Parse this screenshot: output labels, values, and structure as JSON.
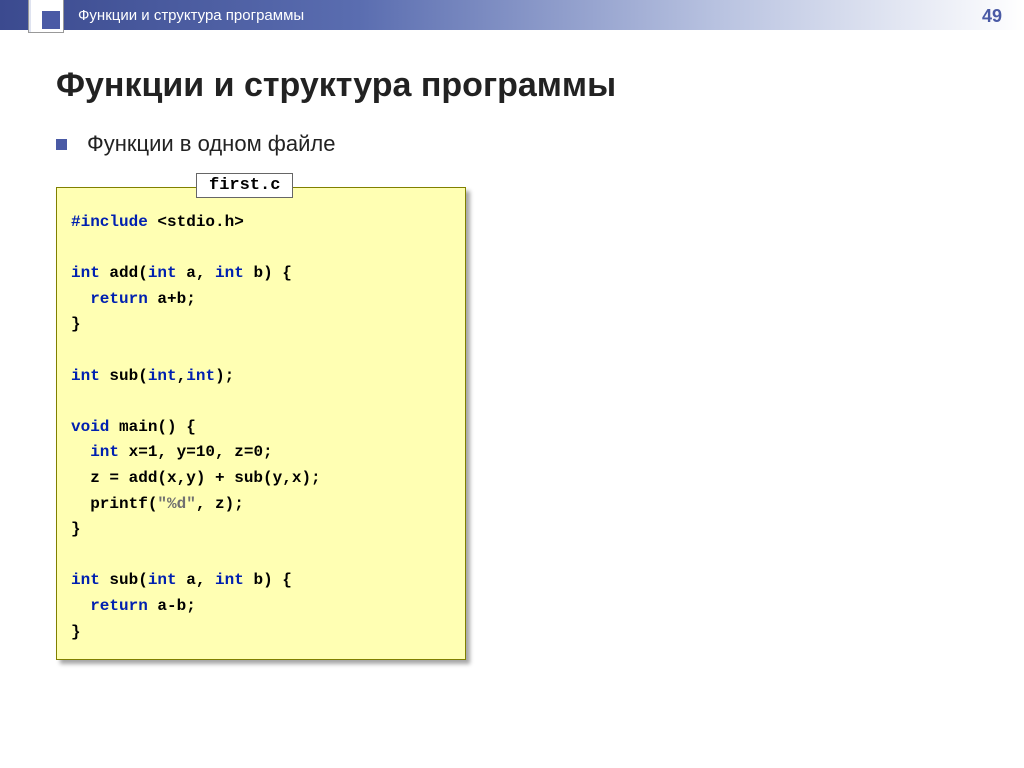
{
  "header": {
    "breadcrumb": "Функции и структура программы",
    "page_number": "49"
  },
  "title": "Функции и структура программы",
  "bullet": "Функции в одном файле",
  "code": {
    "filename": "first.c",
    "line01_a": "#include",
    "line01_b": " <stdio.h>",
    "line02_a": "int",
    "line02_b": " add(",
    "line02_c": "int",
    "line02_d": " a, ",
    "line02_e": "int",
    "line02_f": " b) {",
    "line03_a": "  return",
    "line03_b": " a+b;",
    "line04": "}",
    "line05_a": "int",
    "line05_b": " sub(",
    "line05_c": "int",
    "line05_d": ",",
    "line05_e": "int",
    "line05_f": ");",
    "line06_a": "void",
    "line06_b": " main() {",
    "line07_a": "  int",
    "line07_b": " x=1, y=10, z=0;",
    "line08": "  z = add(x,y) + sub(y,x);",
    "line09_a": "  printf(",
    "line09_b": "\"%d\"",
    "line09_c": ", z);",
    "line10": "}",
    "line11_a": "int",
    "line11_b": " sub(",
    "line11_c": "int",
    "line11_d": " a, ",
    "line11_e": "int",
    "line11_f": " b) {",
    "line12_a": "  return",
    "line12_b": " a-b;",
    "line13": "}"
  }
}
